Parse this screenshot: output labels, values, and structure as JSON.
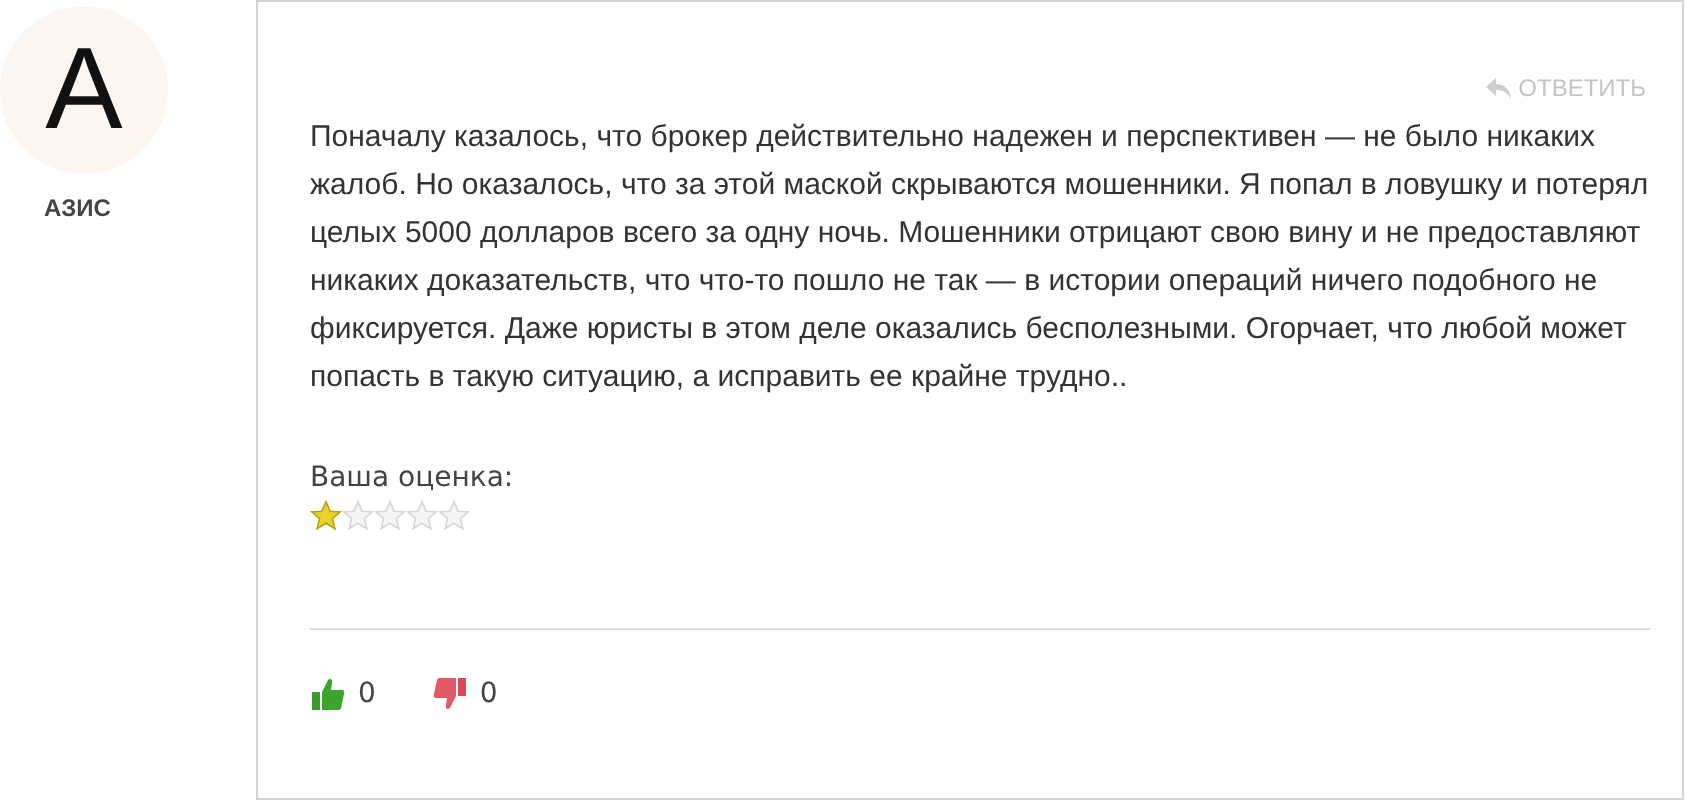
{
  "author": {
    "initial": "А",
    "name": "АЗИС"
  },
  "reply": "ОТВЕТИТЬ",
  "text": "Поначалу казалось, что брокер действительно надежен и перспективен — не было никаких жалоб. Но оказалось, что за этой маской скрываются мошенники. Я попал в ловушку и потерял целых 5000 долларов всего за одну ночь. Мошенники отрицают свою вину и не предоставляют никаких доказательств, что что-то пошло не так — в истории операций ничего подобного не фиксируется. Даже юристы в этом деле оказались бесполезными. Огорчает, что любой может попасть в такую ситуацию, а исправить ее крайне трудно..",
  "rating": {
    "label": "Ваша оценка:",
    "stars": 1
  },
  "votes": {
    "likes": "0",
    "dislikes": "0"
  }
}
